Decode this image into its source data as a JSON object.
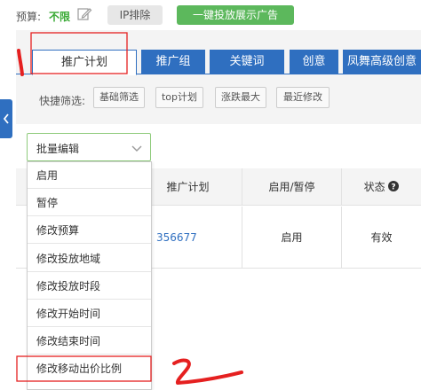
{
  "topbar": {
    "budget_label": "预算:",
    "budget_value": "不限",
    "ip_exclude_label": "IP排除",
    "launch_ads_label": "一键投放展示广告"
  },
  "tabs": [
    {
      "label": "推广计划",
      "active": true
    },
    {
      "label": "推广组",
      "active": false
    },
    {
      "label": "关键词",
      "active": false
    },
    {
      "label": "创意",
      "active": false
    },
    {
      "label": "凤舞高级创意",
      "active": false
    }
  ],
  "filters": {
    "label": "快捷筛选:",
    "chips": [
      "基础筛选",
      "top计划",
      "涨跌最大",
      "最近修改"
    ]
  },
  "batch_edit": {
    "label": "批量编辑",
    "options": [
      "启用",
      "暂停",
      "修改预算",
      "修改投放地域",
      "修改投放时段",
      "修改开始时间",
      "修改结束时间",
      "修改移动出价比例"
    ]
  },
  "table": {
    "headers": [
      "推广计划",
      "启用/暂停",
      "状态"
    ],
    "rows": [
      {
        "plan": "356677",
        "enabled": "启用",
        "status": "有效"
      }
    ]
  },
  "colors": {
    "primary_blue": "#2f6fc0",
    "green": "#5cb85c",
    "annotation_red": "#e52020"
  },
  "icons": {
    "edit": "edit-icon",
    "chevron": "chevron-down-icon",
    "help": "help-icon",
    "collapse": "chevron-left-icon"
  }
}
